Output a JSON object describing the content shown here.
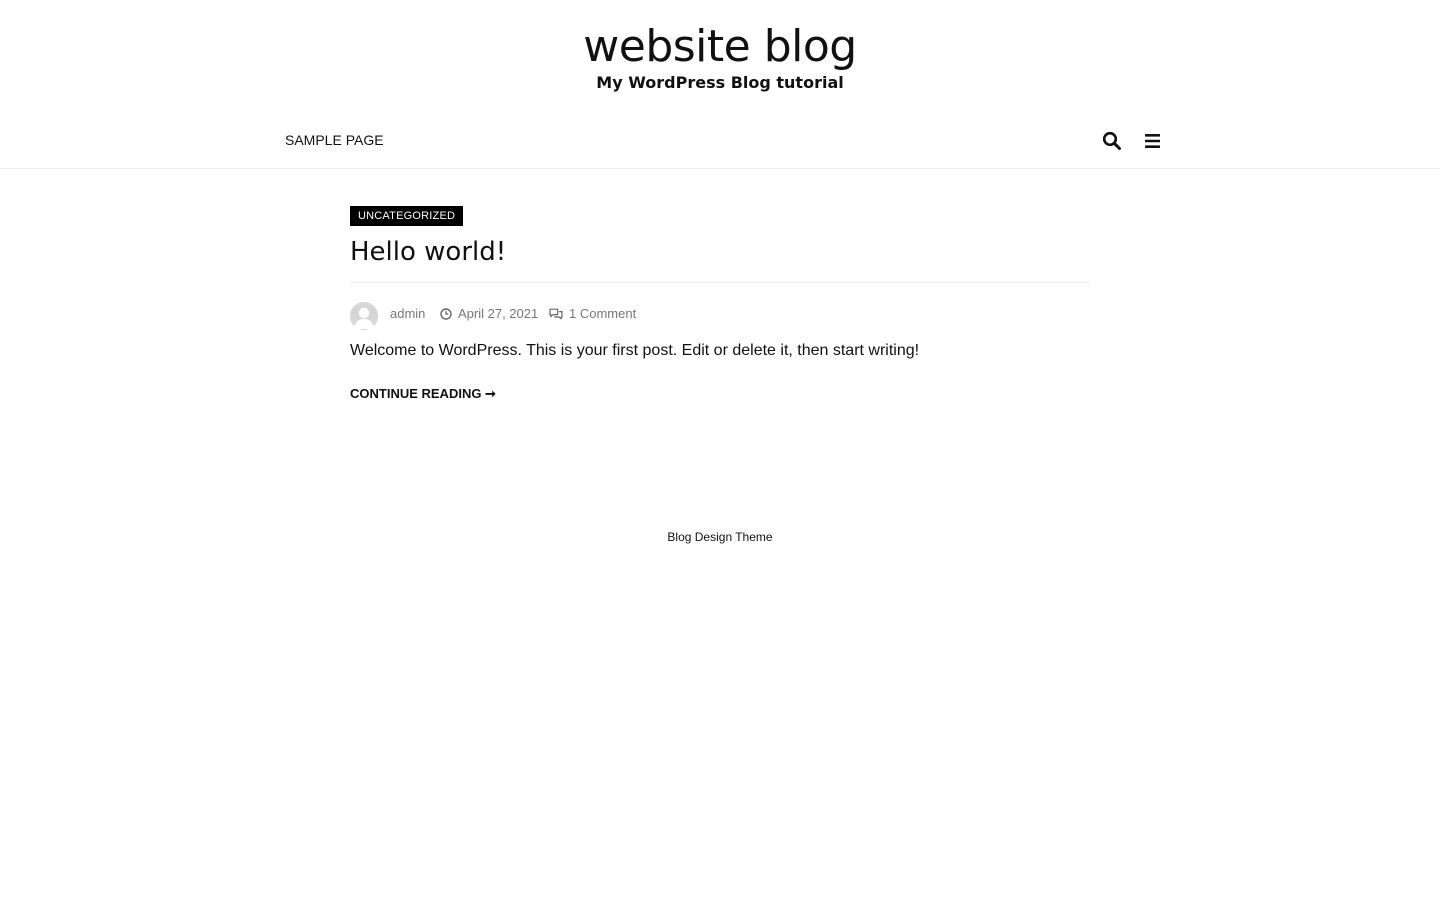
{
  "header": {
    "site_title": "website blog",
    "tagline": "My WordPress Blog tutorial"
  },
  "nav": {
    "items": [
      {
        "label": "SAMPLE PAGE"
      }
    ],
    "icons": [
      "search-icon",
      "menu-icon"
    ]
  },
  "post": {
    "category": "UNCATEGORIZED",
    "title": "Hello world!",
    "author": "admin",
    "date": "April 27, 2021",
    "comments": "1 Comment",
    "excerpt": "Welcome to WordPress. This is your first post. Edit or delete it, then start writing!",
    "continue_label": "CONTINUE READING ➞"
  },
  "footer": {
    "credit": "Blog Design Theme"
  },
  "colors": {
    "text": "#111111",
    "meta": "#777777",
    "badge_bg": "#000000",
    "divider": "#ececec"
  }
}
